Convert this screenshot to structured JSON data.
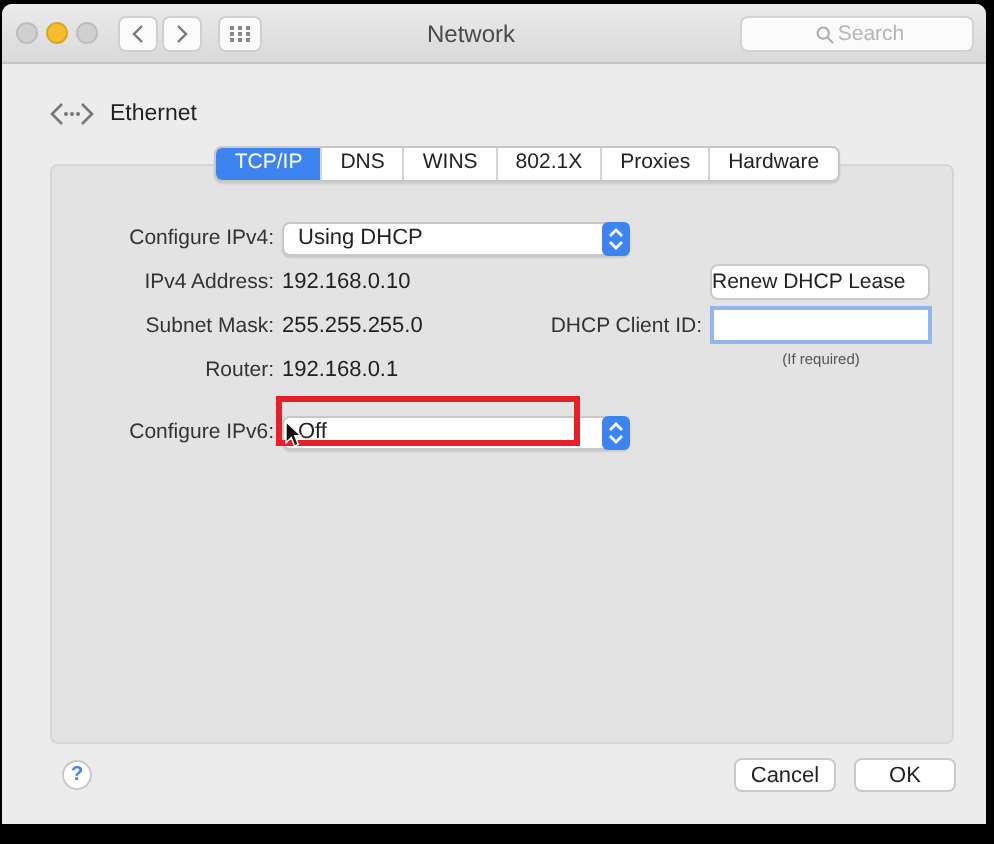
{
  "window": {
    "title": "Network",
    "search": {
      "placeholder": "Search"
    }
  },
  "interface": {
    "name": "Ethernet"
  },
  "tabs": [
    {
      "label": "TCP/IP",
      "selected": true
    },
    {
      "label": "DNS",
      "selected": false
    },
    {
      "label": "WINS",
      "selected": false
    },
    {
      "label": "802.1X",
      "selected": false
    },
    {
      "label": "Proxies",
      "selected": false
    },
    {
      "label": "Hardware",
      "selected": false
    }
  ],
  "ipv4": {
    "label": "Configure IPv4:",
    "value": "Using DHCP"
  },
  "fields": [
    {
      "label": "IPv4 Address:",
      "value": "192.168.0.10"
    },
    {
      "label": "Subnet Mask:",
      "value": "255.255.255.0"
    },
    {
      "label": "Router:",
      "value": "192.168.0.1"
    }
  ],
  "renew_button": "Renew DHCP Lease",
  "client_id": {
    "label": "DHCP Client ID:",
    "hint": "(If required)"
  },
  "ipv6": {
    "label": "Configure IPv6:",
    "value": "Off",
    "highlighted": true
  },
  "help": "?",
  "buttons": [
    {
      "label": "Cancel"
    },
    {
      "label": "OK"
    }
  ]
}
